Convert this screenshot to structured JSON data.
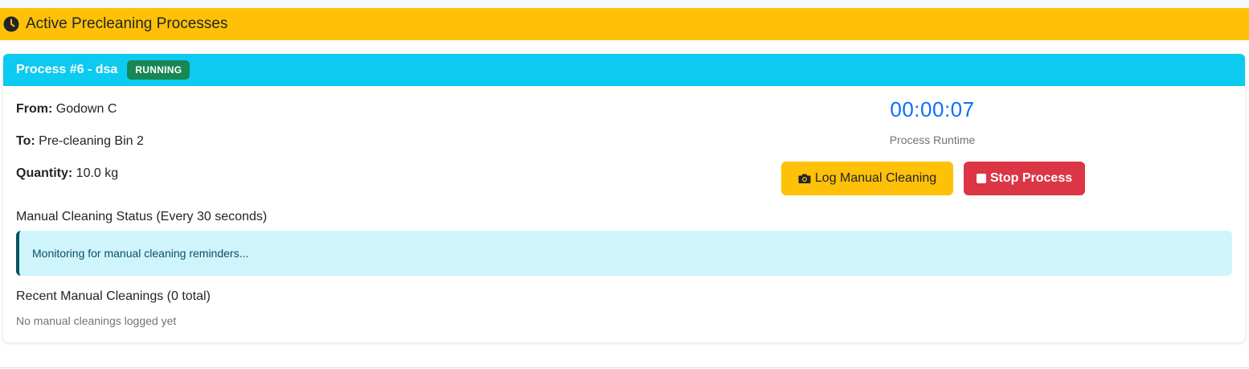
{
  "section": {
    "title": "Active Precleaning Processes",
    "icon": "clock-icon",
    "color": "#ffc107"
  },
  "process": {
    "title": "Process #6 - dsa",
    "status": "RUNNING",
    "header_color": "#0dcaf0",
    "status_color": "#198754",
    "from_label": "From:",
    "from_value": "Godown C",
    "to_label": "To:",
    "to_value": "Pre-cleaning Bin 2",
    "quantity_label": "Quantity:",
    "quantity_value": "10.0 kg",
    "runtime": "00:00:07",
    "runtime_label": "Process Runtime",
    "log_button": "Log Manual Cleaning",
    "log_button_icon": "camera-icon",
    "stop_button": "Stop Process",
    "stop_button_icon": "stop-icon",
    "cleaning_status_heading": "Manual Cleaning Status (Every 30 seconds)",
    "cleaning_status_message": "Monitoring for manual cleaning reminders...",
    "recent_heading": "Recent Manual Cleanings (0 total)",
    "recent_empty": "No manual cleanings logged yet"
  }
}
